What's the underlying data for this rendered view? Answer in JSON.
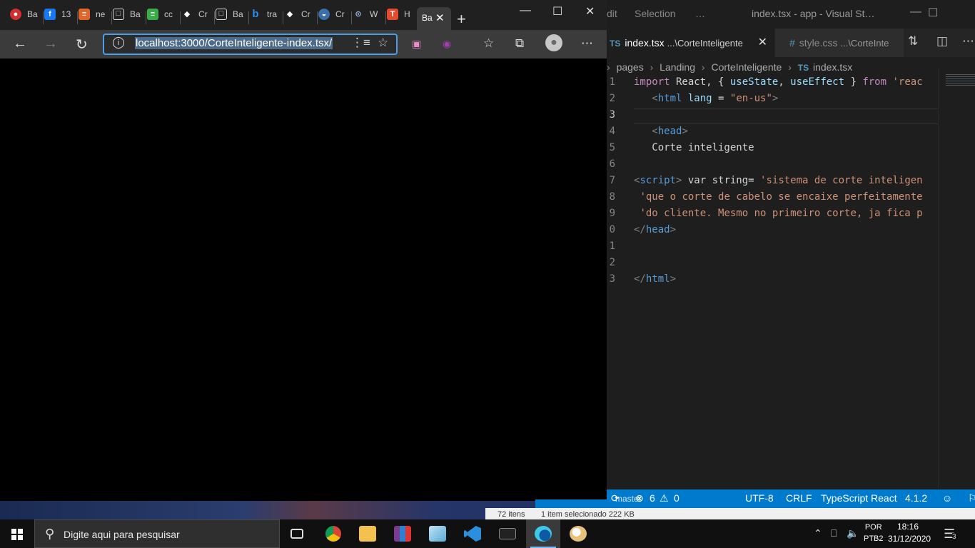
{
  "vscode": {
    "menu": [
      "dit",
      "Selection",
      "…"
    ],
    "title": "index.tsx - app - Visual St…",
    "tabs": [
      {
        "badge": "TS",
        "name": "index.tsx",
        "path": "...\\CorteInteligente",
        "close": "✕"
      },
      {
        "badge": "#",
        "name": "style.css",
        "path": "...\\CorteInte"
      }
    ],
    "breadcrumb": {
      "items": [
        "pages",
        "Landing",
        "CorteInteligente"
      ],
      "file_badge": "TS",
      "file": "index.tsx"
    },
    "line_numbers": [
      "1",
      "2",
      "3",
      "4",
      "5",
      "6",
      "7",
      "8",
      "9",
      "0",
      "1",
      "2",
      "3"
    ],
    "code": {
      "l1": {
        "kw": "import",
        "a": " React, { ",
        "b": "useState",
        "c": ", ",
        "d": "useEffect",
        "e": " } ",
        "f": "from",
        "g": " 'reac"
      },
      "l2": {
        "indent": "   ",
        "open": "<",
        "tag": "html",
        "attr": " lang",
        "eq": " = ",
        "val": "\"en-us\"",
        "close": ">"
      },
      "l4": {
        "indent": "   ",
        "open": "<",
        "tag": "head",
        "close": ">"
      },
      "l5": {
        "text": "   Corte inteligente"
      },
      "l7": {
        "open": "<",
        "tag": "script",
        "close": ">",
        "a": " var string= ",
        "str": "'sistema de corte inteligen"
      },
      "l8": {
        "indent": " ",
        "str": "'que o corte de cabelo se encaixe perfeitamente"
      },
      "l9": {
        "indent": " ",
        "str": "'do cliente. Mesmo no primeiro corte, ja fica p"
      },
      "l10": {
        "open": "</",
        "tag": "head",
        "close": ">"
      },
      "l13": {
        "open": "</",
        "tag": "html",
        "close": ">"
      }
    },
    "status": {
      "branch": "master",
      "errors": "6",
      "warnings": "0",
      "encoding": "UTF-8",
      "eol": "CRLF",
      "language": "TypeScript React",
      "version": "4.1.2"
    }
  },
  "browser": {
    "tabs": [
      {
        "label": "Ba",
        "color": "#d32f2f",
        "glyph": "●"
      },
      {
        "label": "13",
        "color": "#1877f2",
        "glyph": "f"
      },
      {
        "label": "ne",
        "color": "#e0652a",
        "glyph": "≡"
      },
      {
        "label": "Ba",
        "color": "#202020",
        "glyph": "□"
      },
      {
        "label": "cc",
        "color": "#3cab4a",
        "glyph": "≡"
      },
      {
        "label": "Cr",
        "color": "#202020",
        "glyph": "◆"
      },
      {
        "label": "Ba",
        "color": "#202020",
        "glyph": "□"
      },
      {
        "label": "tra",
        "color": "#202020",
        "glyph": "b"
      },
      {
        "label": "Cr",
        "color": "#202020",
        "glyph": "◆"
      },
      {
        "label": "Cr",
        "color": "#3a6fa8",
        "glyph": "◒"
      },
      {
        "label": "W",
        "color": "#202020",
        "glyph": "⊙"
      },
      {
        "label": "H",
        "color": "#e64a2e",
        "glyph": "T"
      }
    ],
    "active_tab": {
      "label": "Ba",
      "close": "✕"
    },
    "new_tab": "+",
    "url": "localhost:3000/CorteInteligente-index.tsx/"
  },
  "explorer_status": {
    "items": "72 itens",
    "selection": "1 item selecionado  222 KB"
  },
  "taskbar": {
    "search_placeholder": "Digite aqui para pesquisar",
    "lang": "POR",
    "layout": "PTB2",
    "time": "18:16",
    "date": "31/12/2020",
    "notifications": "3"
  },
  "icons": {
    "back": "back-arrow-icon",
    "forward": "forward-arrow-icon",
    "refresh": "refresh-icon",
    "favorites": "favorites-icon",
    "collections": "collections-icon",
    "profile": "profile-icon"
  },
  "colors": {
    "vscode_status": "#007acc",
    "address_focus": "#4a9fe8"
  }
}
